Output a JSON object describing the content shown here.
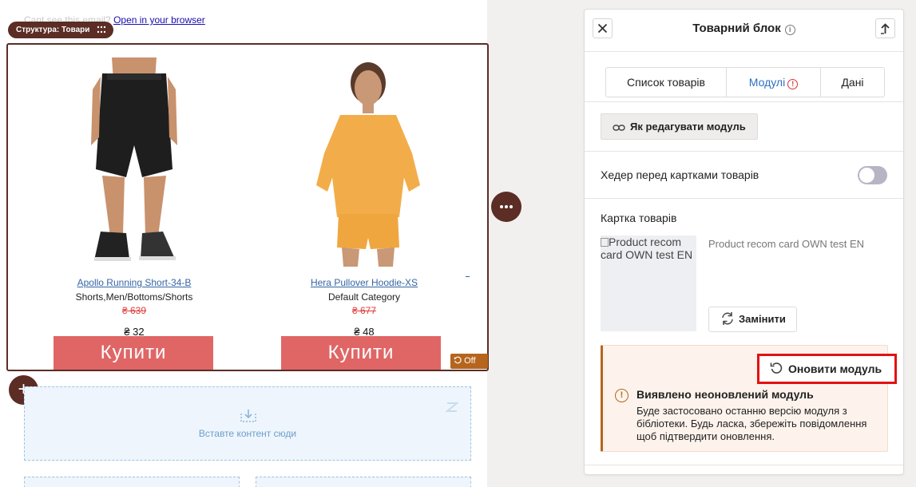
{
  "email": {
    "preheader_text": "Cant see this email?",
    "preheader_link": "Open in your browser",
    "structure_tag": "Структура: Товари",
    "products": [
      {
        "name": "Apollo Running Short-34-B",
        "category": "Shorts,Men/Bottoms/Shorts",
        "old_price": "₴ 639",
        "price": "₴ 32",
        "button": "Купити"
      },
      {
        "name": "Hera Pullover Hoodie-XS",
        "category": "Default Category",
        "old_price": "₴ 677",
        "price": "₴ 48",
        "button": "Купити"
      }
    ],
    "off_badge": "Off",
    "dropzone_text": "Вставте контент сюди"
  },
  "panel": {
    "title": "Товарний блок",
    "tabs": [
      {
        "label": "Список товарів",
        "active": false
      },
      {
        "label": "Модулі",
        "active": true,
        "warning": true
      },
      {
        "label": "Дані",
        "active": false
      }
    ],
    "howto_button": "Як редагувати модуль",
    "header_toggle_label": "Хедер перед картками товарів",
    "header_toggle_on": false,
    "card_section_label": "Картка товарів",
    "card_thumb_alt": "Product recom card OWN test EN",
    "card_name": "Product recom card OWN test EN",
    "replace_button": "Замінити",
    "update_button": "Оновити модуль",
    "alert_title": "Виявлено неоновлений модуль",
    "alert_text": "Буде застосовано останню версію модуля з бібліотеки. Будь ласка, збережіть повідомлення щоб підтвердити оновлення."
  },
  "colors": {
    "accent_dark": "#5b2d24",
    "buy_button": "#e06666",
    "tab_active": "#2f6fc0",
    "alert_border": "#b5651d",
    "highlight": "#e21111"
  }
}
